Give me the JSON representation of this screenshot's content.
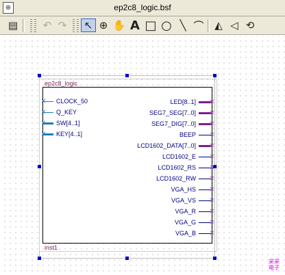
{
  "window": {
    "title": "ep2c8_logic.bsf",
    "doc_icon_glyph": "⊕"
  },
  "toolbar": {
    "buttons": [
      {
        "name": "block-icon",
        "glyph": "▤"
      },
      {
        "name": "undo-icon",
        "glyph": "↶"
      },
      {
        "name": "redo-icon",
        "glyph": "↷"
      },
      {
        "name": "pointer-icon",
        "glyph": "↖"
      },
      {
        "name": "zoom-icon",
        "glyph": "⊕"
      },
      {
        "name": "hand-icon",
        "glyph": "✋"
      },
      {
        "name": "text-icon",
        "glyph": "A"
      },
      {
        "name": "rectangle-icon",
        "glyph": "□"
      },
      {
        "name": "ellipse-icon",
        "glyph": "○"
      },
      {
        "name": "line-icon",
        "glyph": "╲"
      },
      {
        "name": "arc-icon",
        "glyph": "⌒"
      },
      {
        "name": "flip-horizontal-icon",
        "glyph": "◭"
      },
      {
        "name": "flip-vertical-icon",
        "glyph": "◁"
      },
      {
        "name": "rotate-icon",
        "glyph": "⟲"
      }
    ]
  },
  "symbol": {
    "block_name": "ep2c8_logic",
    "instance_name": "inst1",
    "inputs": [
      {
        "label": "CLOCK_50",
        "bus": false
      },
      {
        "label": "Q_KEY",
        "bus": false
      },
      {
        "label": "SW[4..1]",
        "bus": true
      },
      {
        "label": "KEY[4..1]",
        "bus": true
      }
    ],
    "outputs": [
      {
        "label": "LED[8..1]",
        "bus": true
      },
      {
        "label": "SEG7_SEG[7..0]",
        "bus": true
      },
      {
        "label": "SEG7_DIG[7..0]",
        "bus": true
      },
      {
        "label": "BEEP",
        "bus": false
      },
      {
        "label": "LCD1602_DATA[7..0]",
        "bus": true
      },
      {
        "label": "LCD1602_E",
        "bus": false
      },
      {
        "label": "LCD1602_RS",
        "bus": false
      },
      {
        "label": "LCD1602_RW",
        "bus": false
      },
      {
        "label": "VGA_HS",
        "bus": false
      },
      {
        "label": "VGA_VS",
        "bus": false
      },
      {
        "label": "VGA_R",
        "bus": false
      },
      {
        "label": "VGA_G",
        "bus": false
      },
      {
        "label": "VGA_B",
        "bus": false
      }
    ]
  },
  "watermark": {
    "line1": "采采",
    "line2": "电子"
  },
  "colors": {
    "bus_output": "#7a1f8a",
    "bus_input": "#1f7bbf",
    "pin_text": "#000080",
    "block_name": "#7a1f5c",
    "handles": "#0000c8"
  }
}
